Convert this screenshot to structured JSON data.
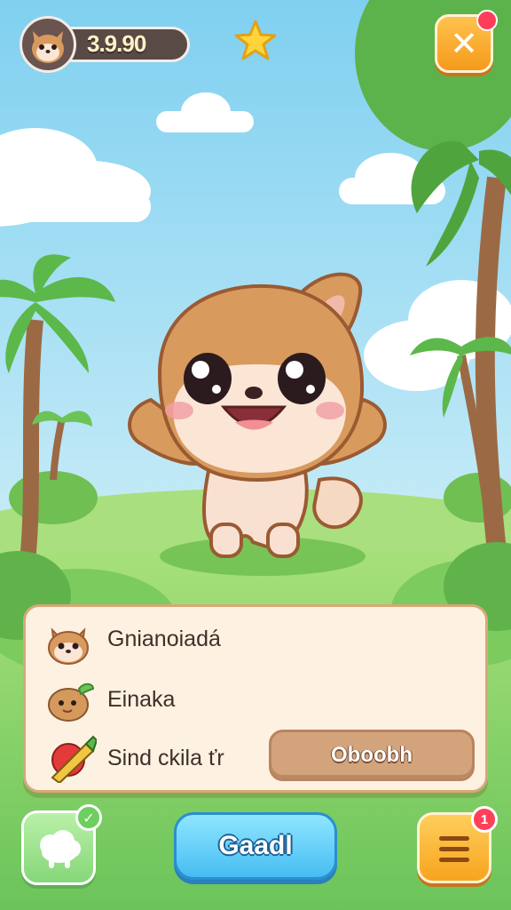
{
  "hud": {
    "coin_amount": "3.9.90",
    "avatar_icon": "fox-face-icon",
    "star_icon": "star-icon",
    "close_icon": "close-icon",
    "close_label": "✕"
  },
  "pet": {
    "character_icon": "fox-pet-character"
  },
  "panel": {
    "rows": [
      {
        "label": "Gnianoiadá",
        "icon": "fox-face-icon"
      },
      {
        "label": "Einaka",
        "icon": "potato-food-icon"
      },
      {
        "label": "Sind ckila ťr",
        "icon": "pencil-tool-icon"
      }
    ],
    "action_label": "Oboobh"
  },
  "bottom_bar": {
    "pet_icon": "sheep-icon",
    "pet_check_label": "✓",
    "main_label": "Gaadl",
    "menu_icon": "menu-icon",
    "menu_badge": "1"
  },
  "colors": {
    "sky": "#9fdcf5",
    "grass": "#8bd36a",
    "accent_orange": "#f7a41e",
    "accent_blue": "#46bdf2",
    "panel_bg": "#fdf2e1"
  }
}
